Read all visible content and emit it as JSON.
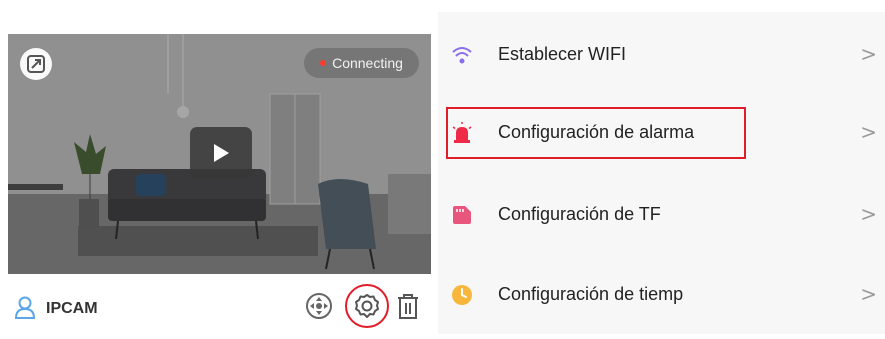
{
  "camera": {
    "status": "Connecting",
    "device_name": "IPCAM"
  },
  "menu": {
    "items": [
      {
        "label": "Establecer WIFI",
        "icon": "wifi-icon",
        "color": "#8b6df0"
      },
      {
        "label": "Configuración de alarma",
        "icon": "alarm-siren-icon",
        "color": "#ee2a48",
        "highlighted": true
      },
      {
        "label": "Configuración de TF",
        "icon": "sd-card-icon",
        "color": "#e8557d"
      },
      {
        "label": "Configuración de tiemp",
        "icon": "clock-icon",
        "color": "#f6b73c"
      }
    ],
    "arrow": ">"
  },
  "colors": {
    "highlight": "#e11d2a"
  }
}
